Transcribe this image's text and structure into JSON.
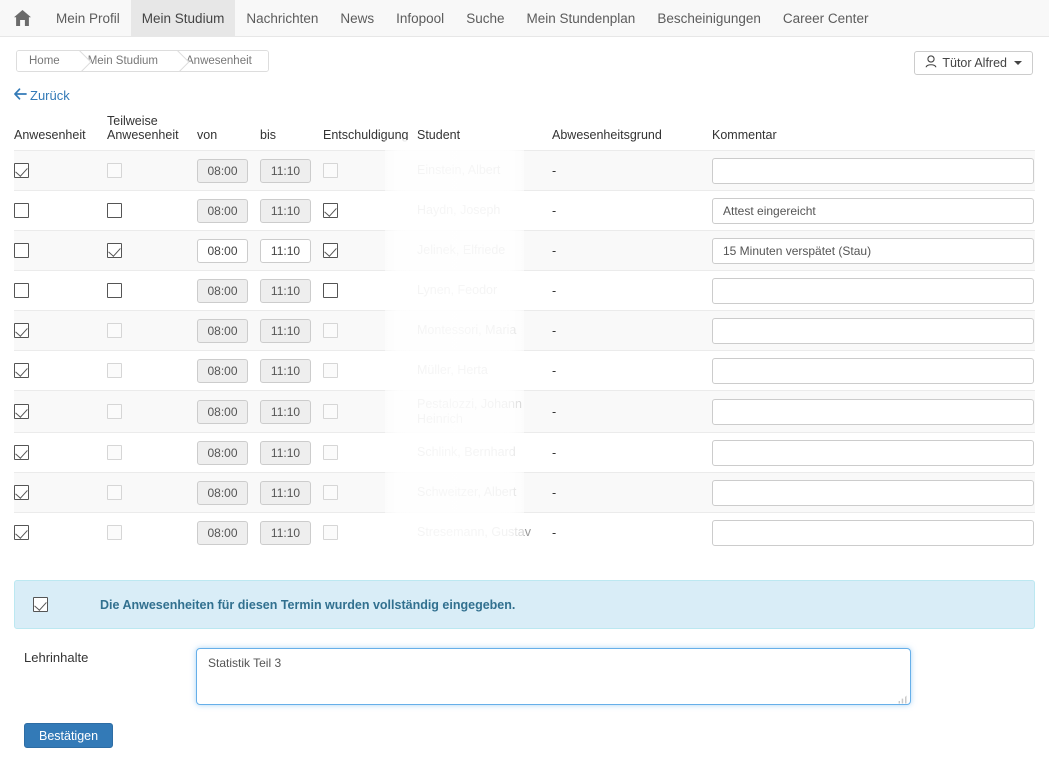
{
  "nav": {
    "home_icon": "home-icon",
    "items": [
      {
        "label": "Mein Profil",
        "active": false
      },
      {
        "label": "Mein Studium",
        "active": true
      },
      {
        "label": "Nachrichten",
        "active": false
      },
      {
        "label": "News",
        "active": false
      },
      {
        "label": "Infopool",
        "active": false
      },
      {
        "label": "Suche",
        "active": false
      },
      {
        "label": "Mein Stundenplan",
        "active": false
      },
      {
        "label": "Bescheinigungen",
        "active": false
      },
      {
        "label": "Career Center",
        "active": false
      }
    ]
  },
  "breadcrumb": {
    "items": [
      {
        "label": "Home"
      },
      {
        "label": "Mein Studium"
      },
      {
        "label": "Anwesenheit"
      }
    ]
  },
  "user_menu": {
    "label": "Tütor Alfred",
    "icon": "user-icon",
    "caret": "caret-down-icon"
  },
  "back_link": {
    "label": "Zurück",
    "icon": "arrow-left-icon"
  },
  "table": {
    "headers": {
      "anwesenheit": "Anwesenheit",
      "teilweise_line1": "Teilweise",
      "teilweise_line2": "Anwesenheit",
      "von": "von",
      "bis": "bis",
      "entschuldigung": "Entschuldigung",
      "student": "Student",
      "abwesenheitsgrund": "Abwesenheitsgrund",
      "kommentar": "Kommentar"
    },
    "rows": [
      {
        "anwesenheit": true,
        "anwesenheit_enabled": true,
        "teilweise": false,
        "teilweise_enabled": false,
        "von": "08:00",
        "bis": "11:10",
        "times_enabled": false,
        "entschuldigung": false,
        "entschuldigung_enabled": false,
        "student": "Einstein, Albert",
        "abwesenheitsgrund": "-",
        "kommentar": ""
      },
      {
        "anwesenheit": false,
        "anwesenheit_enabled": true,
        "teilweise": false,
        "teilweise_enabled": true,
        "von": "08:00",
        "bis": "11:10",
        "times_enabled": false,
        "entschuldigung": true,
        "entschuldigung_enabled": true,
        "student": "Haydn, Joseph",
        "abwesenheitsgrund": "-",
        "kommentar": "Attest eingereicht"
      },
      {
        "anwesenheit": false,
        "anwesenheit_enabled": true,
        "teilweise": true,
        "teilweise_enabled": true,
        "von": "08:00",
        "bis": "11:10",
        "times_enabled": true,
        "entschuldigung": true,
        "entschuldigung_enabled": true,
        "student": "Jelinek, Elfriede",
        "abwesenheitsgrund": "-",
        "kommentar": "15 Minuten verspätet (Stau)"
      },
      {
        "anwesenheit": false,
        "anwesenheit_enabled": true,
        "teilweise": false,
        "teilweise_enabled": true,
        "von": "08:00",
        "bis": "11:10",
        "times_enabled": false,
        "entschuldigung": false,
        "entschuldigung_enabled": true,
        "student": "Lynen, Feodor",
        "abwesenheitsgrund": "-",
        "kommentar": ""
      },
      {
        "anwesenheit": true,
        "anwesenheit_enabled": true,
        "teilweise": false,
        "teilweise_enabled": false,
        "von": "08:00",
        "bis": "11:10",
        "times_enabled": false,
        "entschuldigung": false,
        "entschuldigung_enabled": false,
        "student": "Montessori, Maria",
        "abwesenheitsgrund": "-",
        "kommentar": ""
      },
      {
        "anwesenheit": true,
        "anwesenheit_enabled": true,
        "teilweise": false,
        "teilweise_enabled": false,
        "von": "08:00",
        "bis": "11:10",
        "times_enabled": false,
        "entschuldigung": false,
        "entschuldigung_enabled": false,
        "student": "Müller, Herta",
        "abwesenheitsgrund": "-",
        "kommentar": ""
      },
      {
        "anwesenheit": true,
        "anwesenheit_enabled": true,
        "teilweise": false,
        "teilweise_enabled": false,
        "von": "08:00",
        "bis": "11:10",
        "times_enabled": false,
        "entschuldigung": false,
        "entschuldigung_enabled": false,
        "student": "Pestalozzi, Johann Heinrich",
        "abwesenheitsgrund": "-",
        "kommentar": ""
      },
      {
        "anwesenheit": true,
        "anwesenheit_enabled": true,
        "teilweise": false,
        "teilweise_enabled": false,
        "von": "08:00",
        "bis": "11:10",
        "times_enabled": false,
        "entschuldigung": false,
        "entschuldigung_enabled": false,
        "student": "Schlink, Bernhard",
        "abwesenheitsgrund": "-",
        "kommentar": ""
      },
      {
        "anwesenheit": true,
        "anwesenheit_enabled": true,
        "teilweise": false,
        "teilweise_enabled": false,
        "von": "08:00",
        "bis": "11:10",
        "times_enabled": false,
        "entschuldigung": false,
        "entschuldigung_enabled": false,
        "student": "Schweitzer, Albert",
        "abwesenheitsgrund": "-",
        "kommentar": ""
      },
      {
        "anwesenheit": true,
        "anwesenheit_enabled": true,
        "teilweise": false,
        "teilweise_enabled": false,
        "von": "08:00",
        "bis": "11:10",
        "times_enabled": false,
        "entschuldigung": false,
        "entschuldigung_enabled": false,
        "student": "Stresemann, Gustav",
        "abwesenheitsgrund": "-",
        "kommentar": ""
      }
    ]
  },
  "alert": {
    "checked": true,
    "text": "Die Anwesenheiten für diesen Termin wurden vollständig eingegeben."
  },
  "lehrinhalte": {
    "label": "Lehrinhalte",
    "value": "Statistik Teil 3"
  },
  "confirm_button": {
    "label": "Bestätigen"
  },
  "colors": {
    "accent": "#337ab7",
    "alert_bg": "#d9edf7",
    "alert_border": "#bce8f1",
    "alert_text": "#31708f",
    "nav_bg": "#f8f8f8",
    "nav_active_bg": "#e7e7e7",
    "row_stripe": "#f9f9f9",
    "focus_border": "#66afe9"
  }
}
